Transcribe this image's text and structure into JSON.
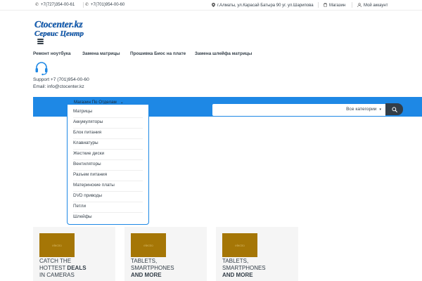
{
  "topbar": {
    "phone1": "+7(727)354-00-61",
    "phone2": "+7(701)954-00-60",
    "address": "г.Алматы, ул.Карасай Батыра 90 уг. ул.Шарипова",
    "shop": "Магазин",
    "account": "Мой аккаунт"
  },
  "logo": {
    "line1": "Ctocenter.kz",
    "line2": "Сервис Центр"
  },
  "nav": {
    "items": [
      "Ремонт ноутбука",
      "Замена матрицы",
      "Прошивка Биос на плате",
      "Замена шлейфа матрицы"
    ]
  },
  "support": {
    "phone": "Support +7 (701)954-00-60",
    "email": "Email: info@ctocenter.kz"
  },
  "departments": {
    "toggle_label": "Магазин По Отделам",
    "items": [
      "Матрицы",
      "Аккумуляторы",
      "Блок питания",
      "Клавиатуры",
      "Жесткие диски",
      "Вентиляторы",
      "Разъем питания",
      "Материнские платы",
      "DVD приводы",
      "Петли",
      "Шлейфы"
    ]
  },
  "search": {
    "placeholder": "",
    "category": "Все категории"
  },
  "cards": [
    {
      "thumb": "electro",
      "line1": "CATCH THE",
      "line2_pre": "HOTTEST ",
      "line2_bold": "DEALS",
      "line3": "IN CAMERAS"
    },
    {
      "thumb": "electro",
      "line1": "TABLETS,",
      "line2_pre": "SMARTPHONES",
      "line2_bold": "",
      "line3_bold": "AND MORE"
    },
    {
      "thumb": "electro",
      "line1": "TABLETS,",
      "line2_pre": "SMARTPHONES",
      "line2_bold": "",
      "line3_bold": "AND MORE"
    }
  ],
  "colors": {
    "accent": "#1e88e5",
    "text": "#333e48",
    "thumb": "#a57606",
    "logo_blue": "#1565c0"
  }
}
